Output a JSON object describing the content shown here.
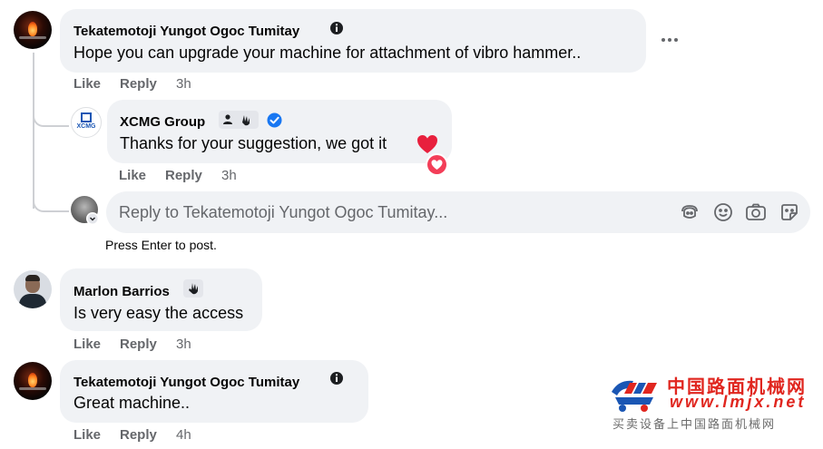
{
  "comments": [
    {
      "author": "Tekatemotoji Yungot Ogoc Tumitay",
      "text": "Hope you can upgrade your machine for attachment of vibro hammer..",
      "like": "Like",
      "reply": "Reply",
      "time": "3h",
      "replies": [
        {
          "author": "XCMG Group",
          "text": "Thanks for your suggestion, we got it",
          "like": "Like",
          "reply": "Reply",
          "time": "3h"
        }
      ]
    },
    {
      "author": "Marlon Barrios",
      "text": "Is very easy the access",
      "like": "Like",
      "reply": "Reply",
      "time": "3h"
    },
    {
      "author": "Tekatemotoji Yungot Ogoc Tumitay",
      "text": "Great machine..",
      "like": "Like",
      "reply": "Reply",
      "time": "4h"
    }
  ],
  "reply_box": {
    "placeholder": "Reply to Tekatemotoji Yungot Ogoc Tumitay...",
    "hint": "Press Enter to post."
  },
  "avatar_logo_text": "XCMG",
  "watermark": {
    "title": "中国路面机械网",
    "url": "www.lmjx.net",
    "subtitle": "买卖设备上中国路面机械网"
  },
  "colors": {
    "bubble": "#f0f2f5",
    "verified": "#1877f2",
    "heart": "#f33e58",
    "watermark_red": "#e0261f",
    "watermark_blue": "#1a56b4"
  }
}
